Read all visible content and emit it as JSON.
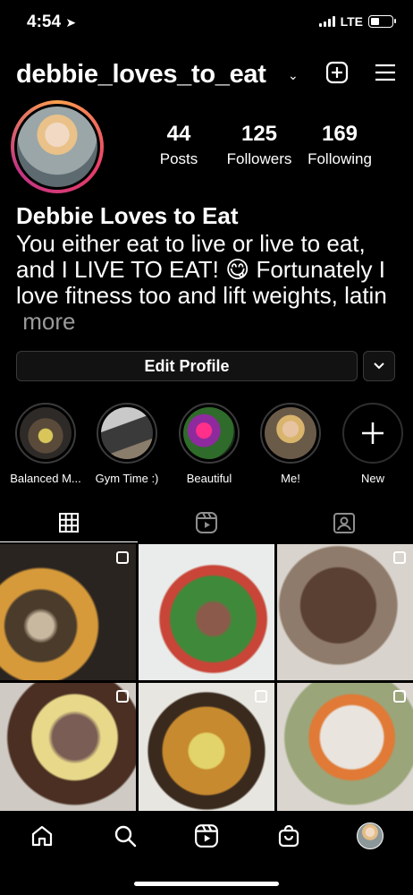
{
  "status": {
    "time": "4:54",
    "network": "LTE",
    "battery_level": 0.35
  },
  "header": {
    "username": "debbie_loves_to_eat"
  },
  "stats": [
    {
      "value": "44",
      "label": "Posts"
    },
    {
      "value": "125",
      "label": "Followers"
    },
    {
      "value": "169",
      "label": "Following"
    }
  ],
  "bio": {
    "name": "Debbie Loves to Eat",
    "text": "You either eat to live or live to eat, and I LIVE TO EAT! 😋 Fortunately I love fitness too and lift weights, latin",
    "more": "more"
  },
  "actions": {
    "edit_profile": "Edit Profile"
  },
  "highlights": [
    {
      "label": "Balanced M..."
    },
    {
      "label": "Gym Time :)"
    },
    {
      "label": "Beautiful"
    },
    {
      "label": "Me!"
    },
    {
      "label": "New"
    }
  ],
  "tabs": [
    "grid-icon",
    "reels-icon",
    "tagged-icon"
  ],
  "posts_count_visible": 6,
  "nav": [
    "home-icon",
    "search-icon",
    "reels-icon",
    "shop-icon",
    "profile-avatar"
  ]
}
